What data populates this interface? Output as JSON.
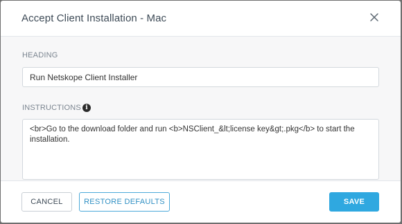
{
  "dialog": {
    "title": "Accept Client Installation - Mac",
    "close_icon": "close-icon"
  },
  "form": {
    "heading_label": "HEADING",
    "heading_value": "Run Netskope Client Installer",
    "instructions_label": "INSTRUCTIONS",
    "info_icon": "info-icon",
    "info_glyph": "i",
    "instructions_value": "<br>Go to the download folder and run <b>NSClient_&lt;license key&gt;.pkg</b> to start the installation."
  },
  "footer": {
    "cancel_label": "CANCEL",
    "restore_label": "RESTORE DEFAULTS",
    "save_label": "SAVE"
  },
  "colors": {
    "accent": "#2fa8e0",
    "title": "#3d4a56",
    "label": "#7b8590"
  }
}
